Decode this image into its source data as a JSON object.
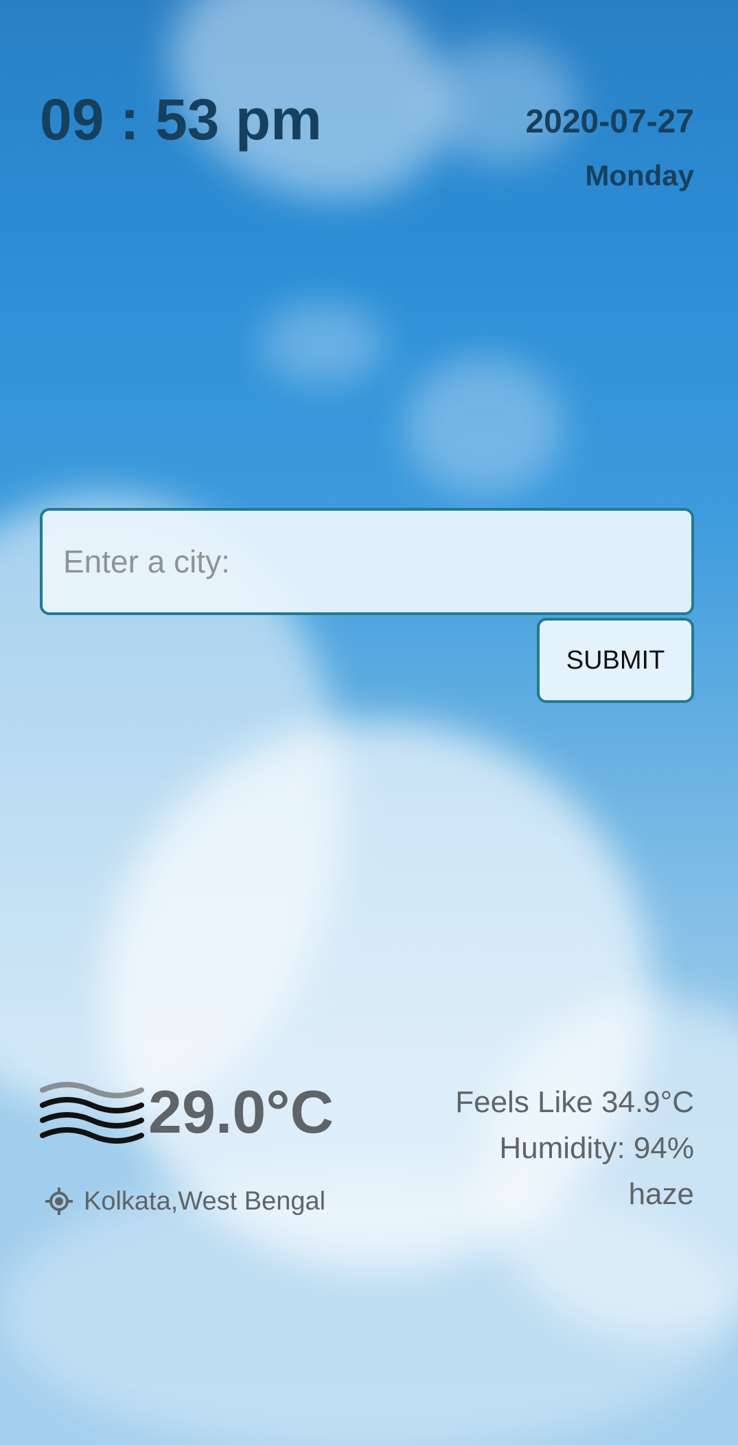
{
  "clock": {
    "time": "09 : 53 pm"
  },
  "date": {
    "date": "2020-07-27",
    "day": "Monday"
  },
  "search": {
    "placeholder": "Enter a city:",
    "value": ""
  },
  "submit": {
    "label": "SUBMIT"
  },
  "weather": {
    "icon": "haze-icon",
    "temperature": "29.0°C",
    "feels_like": "Feels Like 34.9°C",
    "humidity": "Humidity: 94%",
    "condition": "haze",
    "location_icon": "location-target-icon",
    "location": "Kolkata,West Bengal"
  },
  "colors": {
    "text_dark": "#17405f",
    "text_gray": "#5e6468",
    "border_accent": "#227a8f"
  }
}
